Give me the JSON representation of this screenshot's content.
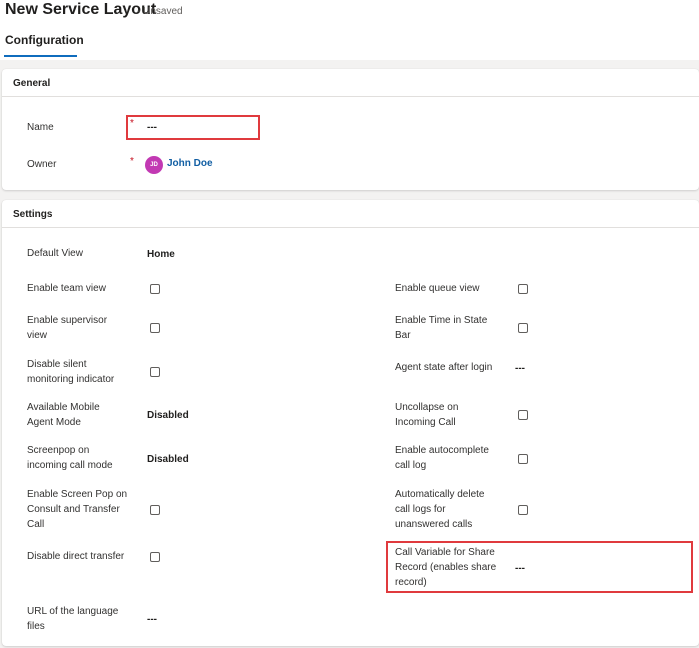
{
  "header": {
    "title": "New Service Layout",
    "status": "- Unsaved",
    "tab": "Configuration"
  },
  "general": {
    "title": "General",
    "name_label": "Name",
    "name_required": "*",
    "name_value": "---",
    "owner_label": "Owner",
    "owner_required": "*",
    "owner_initials": "JD",
    "owner_name": "John Doe"
  },
  "settings": {
    "title": "Settings",
    "default_view_label": "Default View",
    "default_view_value": "Home",
    "team_view_label": "Enable team view",
    "team_view_checked": false,
    "supervisor_view_label": "Enable supervisor view",
    "supervisor_view_checked": false,
    "silent_monitoring_label": "Disable silent monitoring indicator",
    "silent_monitoring_checked": false,
    "mobile_agent_label": "Available Mobile Agent Mode",
    "mobile_agent_value": "Disabled",
    "screenpop_mode_label": "Screenpop on incoming call mode",
    "screenpop_mode_value": "Disabled",
    "screen_pop_consult_label": "Enable Screen Pop on Consult and Transfer Call",
    "screen_pop_consult_checked": false,
    "direct_transfer_label": "Disable direct transfer",
    "direct_transfer_checked": false,
    "language_url_label": "URL of the language files",
    "language_url_value": "---",
    "queue_view_label": "Enable queue view",
    "queue_view_checked": false,
    "time_in_state_label": "Enable Time in State Bar",
    "time_in_state_checked": false,
    "agent_state_label": "Agent state after login",
    "agent_state_value": "---",
    "uncollapse_label": "Uncollapse on Incoming Call",
    "uncollapse_checked": false,
    "autocomplete_label": "Enable autocomplete call log",
    "autocomplete_checked": false,
    "auto_delete_label": "Automatically delete call logs for unanswered calls",
    "auto_delete_checked": false,
    "call_variable_label": "Call Variable for Share Record (enables share record)",
    "call_variable_value": "---"
  },
  "colors": {
    "accent": "#0f6cbd",
    "highlight": "#e03a3e",
    "required": "#c50f1f",
    "avatar": "#c239b3",
    "link": "#115ea3"
  }
}
